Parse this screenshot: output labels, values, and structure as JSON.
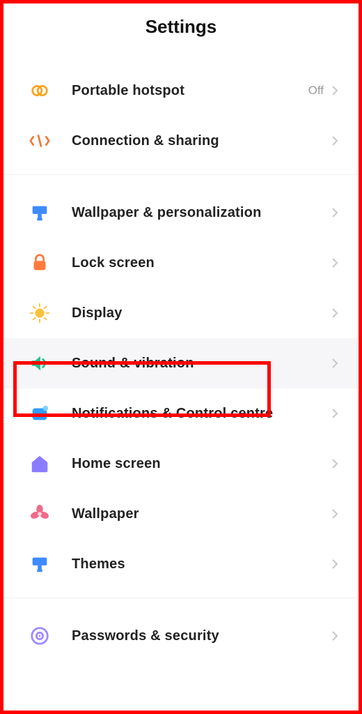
{
  "header": {
    "title": "Settings"
  },
  "groups": [
    {
      "items": [
        {
          "key": "hotspot",
          "icon": "hotspot-icon",
          "label": "Portable hotspot",
          "value": "Off"
        },
        {
          "key": "connection",
          "icon": "link-icon",
          "label": "Connection & sharing"
        }
      ]
    },
    {
      "items": [
        {
          "key": "wallpaper-personalization",
          "icon": "brush-icon",
          "label": "Wallpaper & personalization"
        },
        {
          "key": "lock-screen",
          "icon": "lock-icon",
          "label": "Lock screen"
        },
        {
          "key": "display",
          "icon": "sun-icon",
          "label": "Display"
        },
        {
          "key": "sound",
          "icon": "sound-icon",
          "label": "Sound & vibration",
          "highlighted": true
        },
        {
          "key": "notifications",
          "icon": "notifications-icon",
          "label": "Notifications & Control centre"
        },
        {
          "key": "home-screen",
          "icon": "home-icon",
          "label": "Home screen"
        },
        {
          "key": "wallpaper",
          "icon": "flower-icon",
          "label": "Wallpaper"
        },
        {
          "key": "themes",
          "icon": "themes-icon",
          "label": "Themes"
        }
      ]
    },
    {
      "items": [
        {
          "key": "passwords",
          "icon": "shield-icon",
          "label": "Passwords & security"
        }
      ]
    }
  ],
  "colors": {
    "hotspot": "#f6a623",
    "link": "#f07b3c",
    "brush": "#3d8bff",
    "lock": "#ff7a3d",
    "sun": "#f8c23a",
    "sound": "#27c28a",
    "notifications": "#2f9dff",
    "home": "#8b7bff",
    "flower": "#f06a8a",
    "themes": "#3d8bff",
    "shield": "#9f8aff"
  }
}
